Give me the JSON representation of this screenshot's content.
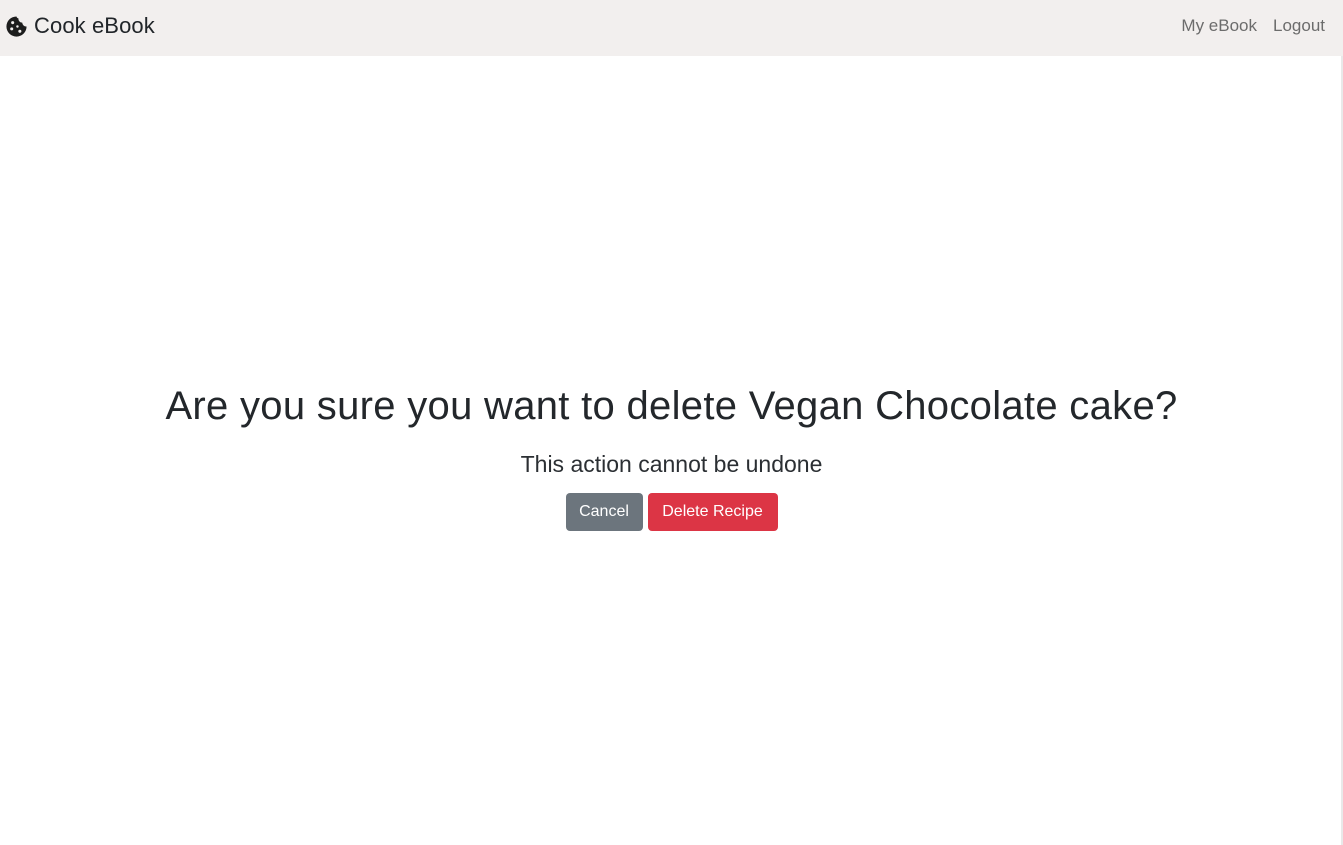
{
  "navbar": {
    "brand_icon": "cookie-icon",
    "brand_title": "Cook eBook",
    "links": [
      {
        "label": "My eBook"
      },
      {
        "label": "Logout"
      }
    ],
    "background": "#f2efee"
  },
  "confirm": {
    "question": "Are you sure you want to delete Vegan Chocolate cake?",
    "subtext": "This action cannot be undone",
    "cancel_label": "Cancel",
    "delete_label": "Delete Recipe"
  },
  "colors": {
    "cancel": "#6c757d",
    "delete": "#dc3545"
  }
}
